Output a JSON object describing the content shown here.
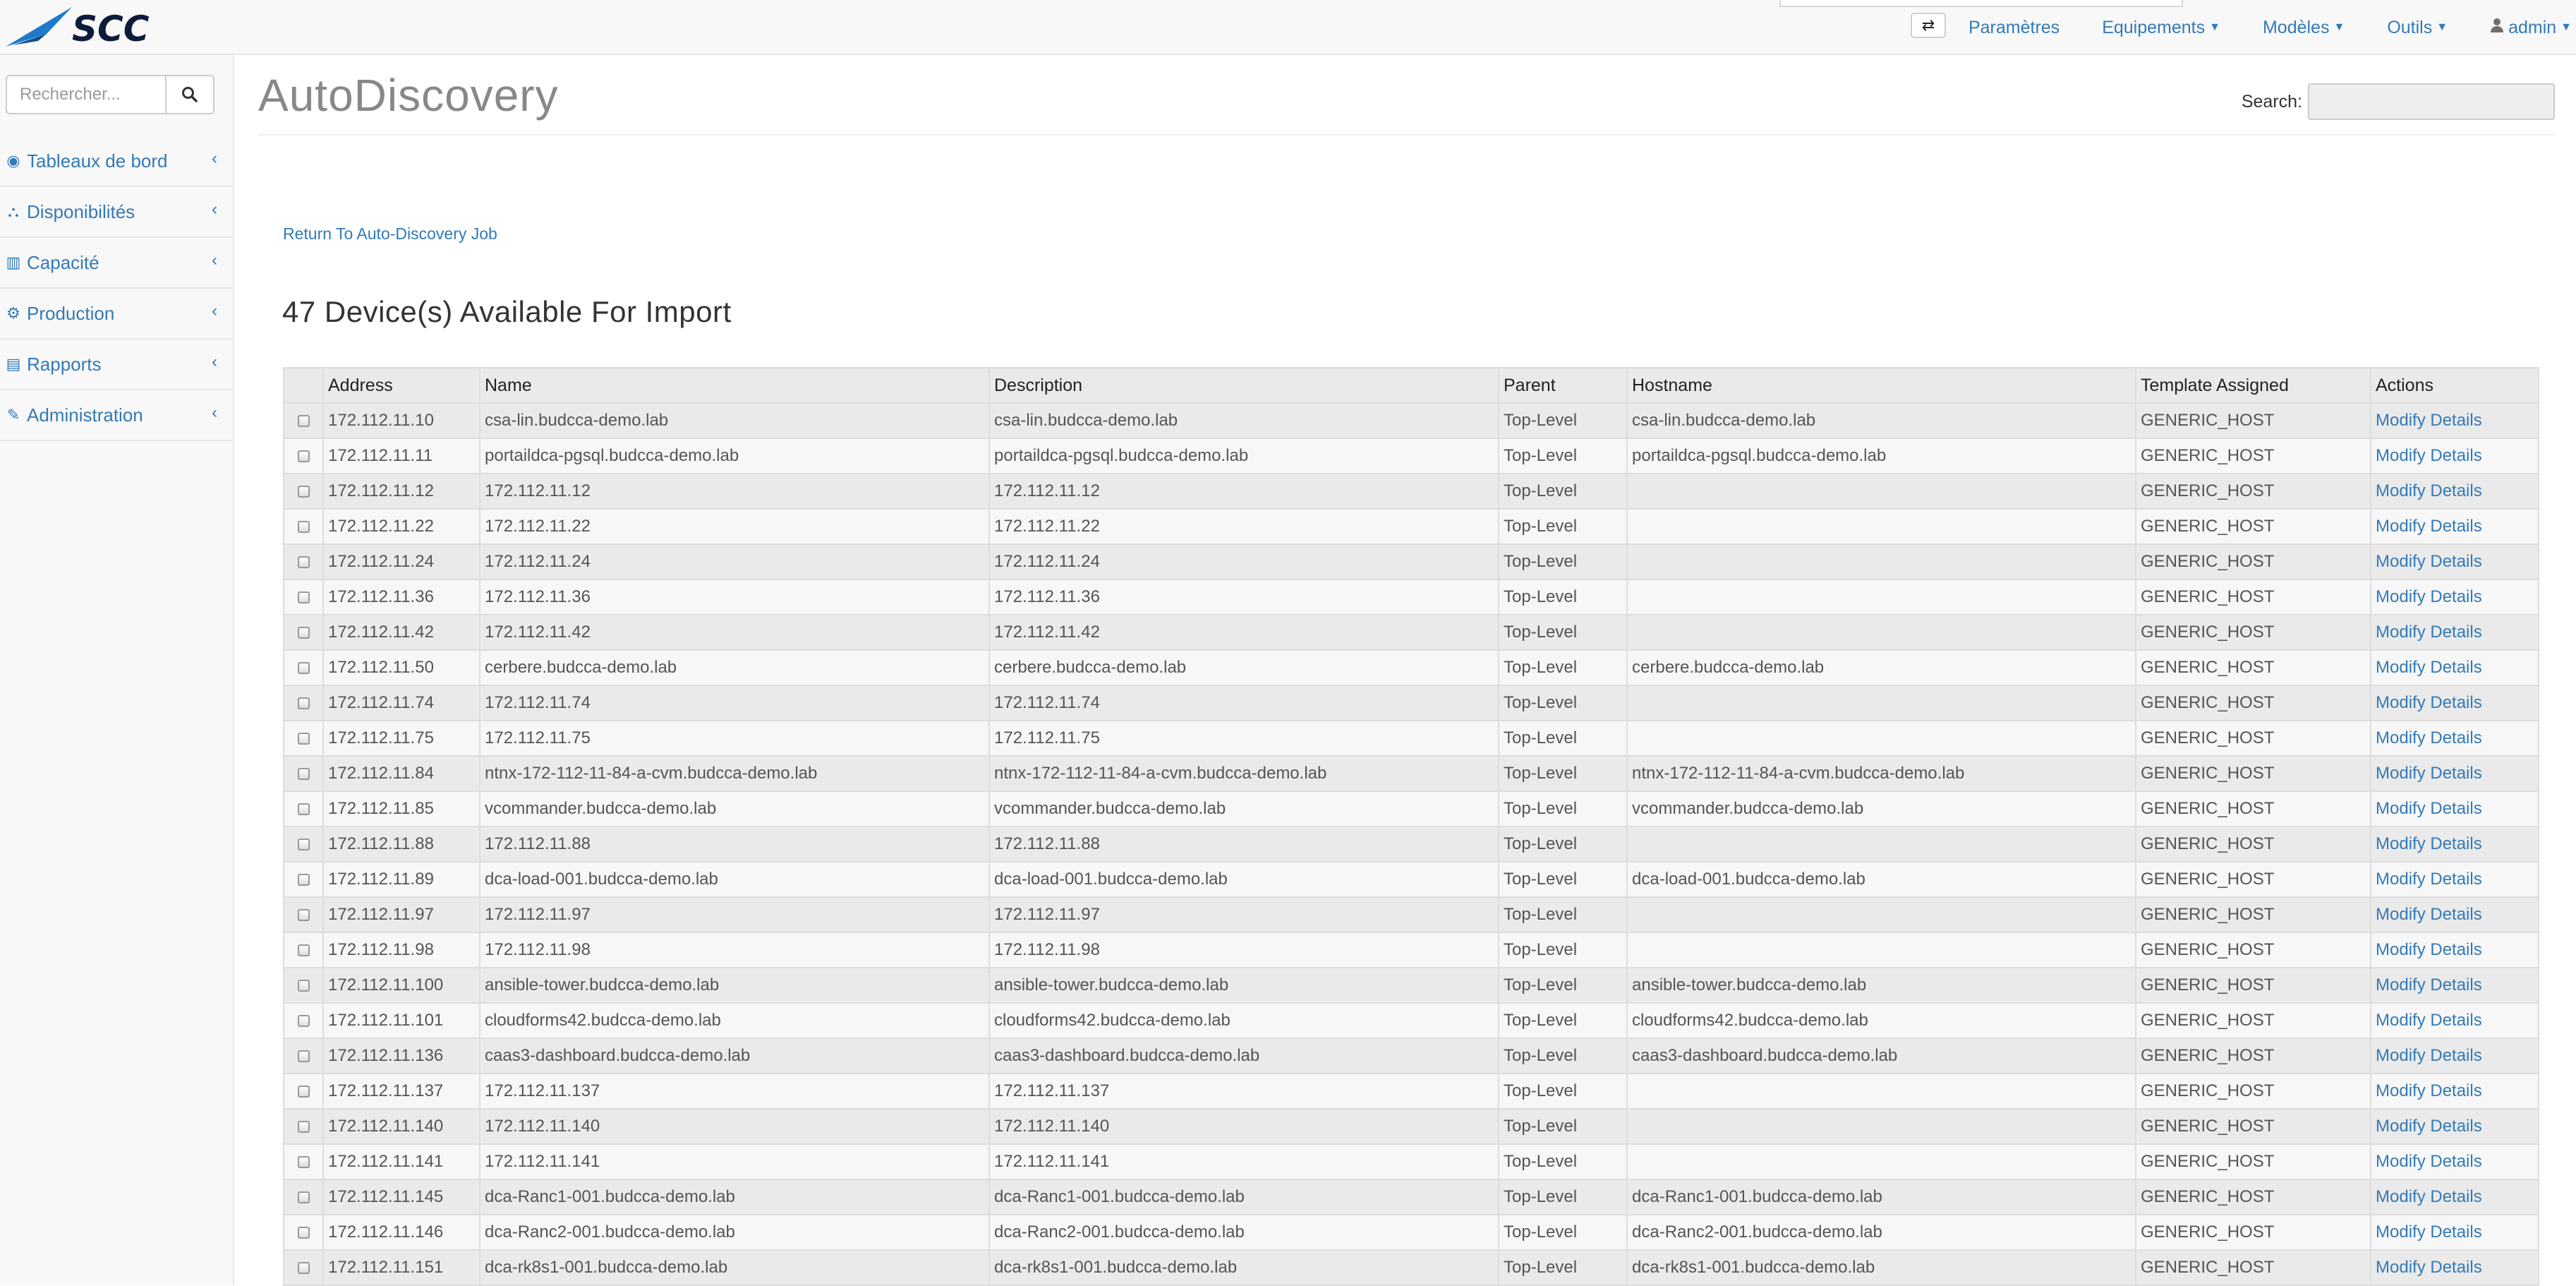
{
  "brand": {
    "logo_text": "SCC"
  },
  "navbar": {
    "items": [
      {
        "label": "Paramètres",
        "caret": false
      },
      {
        "label": "Equipements",
        "caret": true
      },
      {
        "label": "Modèles",
        "caret": true
      },
      {
        "label": "Outils",
        "caret": true
      },
      {
        "label": "admin",
        "caret": true,
        "icon": "user-icon"
      }
    ],
    "toggle_icon": "exchange-icon"
  },
  "sidebar": {
    "search_placeholder": "Rechercher...",
    "items": [
      {
        "label": "Tableaux de bord",
        "icon": "dashboard-icon",
        "glyph": "◉"
      },
      {
        "label": "Disponibilités",
        "icon": "sitemap-icon",
        "glyph": "⛬"
      },
      {
        "label": "Capacité",
        "icon": "bar-chart-icon",
        "glyph": "▥"
      },
      {
        "label": "Production",
        "icon": "cogs-icon",
        "glyph": "⚙"
      },
      {
        "label": "Rapports",
        "icon": "file-text-icon",
        "glyph": "▤"
      },
      {
        "label": "Administration",
        "icon": "wrench-icon",
        "glyph": "✎"
      }
    ]
  },
  "main": {
    "title": "AutoDiscovery",
    "search_label": "Search:",
    "return_link": "Return To Auto-Discovery Job",
    "count_heading": "47 Device(s) Available For Import"
  },
  "table": {
    "headers": [
      "",
      "Address",
      "Name",
      "Description",
      "Parent",
      "Hostname",
      "Template Assigned",
      "Actions"
    ],
    "action_label": "Modify Details",
    "rows": [
      [
        "172.112.11.10",
        "csa-lin.budcca-demo.lab",
        "csa-lin.budcca-demo.lab",
        "Top-Level",
        "csa-lin.budcca-demo.lab",
        "GENERIC_HOST"
      ],
      [
        "172.112.11.11",
        "portaildca-pgsql.budcca-demo.lab",
        "portaildca-pgsql.budcca-demo.lab",
        "Top-Level",
        "portaildca-pgsql.budcca-demo.lab",
        "GENERIC_HOST"
      ],
      [
        "172.112.11.12",
        "172.112.11.12",
        "172.112.11.12",
        "Top-Level",
        "",
        "GENERIC_HOST"
      ],
      [
        "172.112.11.22",
        "172.112.11.22",
        "172.112.11.22",
        "Top-Level",
        "",
        "GENERIC_HOST"
      ],
      [
        "172.112.11.24",
        "172.112.11.24",
        "172.112.11.24",
        "Top-Level",
        "",
        "GENERIC_HOST"
      ],
      [
        "172.112.11.36",
        "172.112.11.36",
        "172.112.11.36",
        "Top-Level",
        "",
        "GENERIC_HOST"
      ],
      [
        "172.112.11.42",
        "172.112.11.42",
        "172.112.11.42",
        "Top-Level",
        "",
        "GENERIC_HOST"
      ],
      [
        "172.112.11.50",
        "cerbere.budcca-demo.lab",
        "cerbere.budcca-demo.lab",
        "Top-Level",
        "cerbere.budcca-demo.lab",
        "GENERIC_HOST"
      ],
      [
        "172.112.11.74",
        "172.112.11.74",
        "172.112.11.74",
        "Top-Level",
        "",
        "GENERIC_HOST"
      ],
      [
        "172.112.11.75",
        "172.112.11.75",
        "172.112.11.75",
        "Top-Level",
        "",
        "GENERIC_HOST"
      ],
      [
        "172.112.11.84",
        "ntnx-172-112-11-84-a-cvm.budcca-demo.lab",
        "ntnx-172-112-11-84-a-cvm.budcca-demo.lab",
        "Top-Level",
        "ntnx-172-112-11-84-a-cvm.budcca-demo.lab",
        "GENERIC_HOST"
      ],
      [
        "172.112.11.85",
        "vcommander.budcca-demo.lab",
        "vcommander.budcca-demo.lab",
        "Top-Level",
        "vcommander.budcca-demo.lab",
        "GENERIC_HOST"
      ],
      [
        "172.112.11.88",
        "172.112.11.88",
        "172.112.11.88",
        "Top-Level",
        "",
        "GENERIC_HOST"
      ],
      [
        "172.112.11.89",
        "dca-load-001.budcca-demo.lab",
        "dca-load-001.budcca-demo.lab",
        "Top-Level",
        "dca-load-001.budcca-demo.lab",
        "GENERIC_HOST"
      ],
      [
        "172.112.11.97",
        "172.112.11.97",
        "172.112.11.97",
        "Top-Level",
        "",
        "GENERIC_HOST"
      ],
      [
        "172.112.11.98",
        "172.112.11.98",
        "172.112.11.98",
        "Top-Level",
        "",
        "GENERIC_HOST"
      ],
      [
        "172.112.11.100",
        "ansible-tower.budcca-demo.lab",
        "ansible-tower.budcca-demo.lab",
        "Top-Level",
        "ansible-tower.budcca-demo.lab",
        "GENERIC_HOST"
      ],
      [
        "172.112.11.101",
        "cloudforms42.budcca-demo.lab",
        "cloudforms42.budcca-demo.lab",
        "Top-Level",
        "cloudforms42.budcca-demo.lab",
        "GENERIC_HOST"
      ],
      [
        "172.112.11.136",
        "caas3-dashboard.budcca-demo.lab",
        "caas3-dashboard.budcca-demo.lab",
        "Top-Level",
        "caas3-dashboard.budcca-demo.lab",
        "GENERIC_HOST"
      ],
      [
        "172.112.11.137",
        "172.112.11.137",
        "172.112.11.137",
        "Top-Level",
        "",
        "GENERIC_HOST"
      ],
      [
        "172.112.11.140",
        "172.112.11.140",
        "172.112.11.140",
        "Top-Level",
        "",
        "GENERIC_HOST"
      ],
      [
        "172.112.11.141",
        "172.112.11.141",
        "172.112.11.141",
        "Top-Level",
        "",
        "GENERIC_HOST"
      ],
      [
        "172.112.11.145",
        "dca-Ranc1-001.budcca-demo.lab",
        "dca-Ranc1-001.budcca-demo.lab",
        "Top-Level",
        "dca-Ranc1-001.budcca-demo.lab",
        "GENERIC_HOST"
      ],
      [
        "172.112.11.146",
        "dca-Ranc2-001.budcca-demo.lab",
        "dca-Ranc2-001.budcca-demo.lab",
        "Top-Level",
        "dca-Ranc2-001.budcca-demo.lab",
        "GENERIC_HOST"
      ],
      [
        "172.112.11.151",
        "dca-rk8s1-001.budcca-demo.lab",
        "dca-rk8s1-001.budcca-demo.lab",
        "Top-Level",
        "dca-rk8s1-001.budcca-demo.lab",
        "GENERIC_HOST"
      ]
    ]
  },
  "colors": {
    "link": "#337ab7",
    "brand_blue": "#1f7ac8",
    "title_gray": "#888888"
  }
}
